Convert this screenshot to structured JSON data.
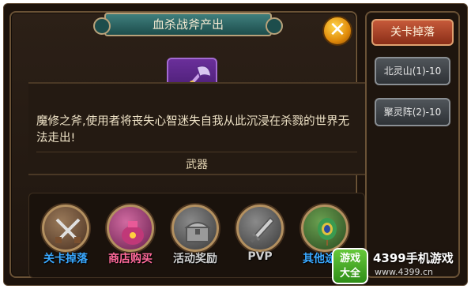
{
  "dialog": {
    "title": "血杀战斧产出",
    "close_glyph": "✕",
    "description": "魔修之斧,使用者将丧失心智迷失自我从此沉浸在杀戮的世界无法走出!",
    "item_type": "武器"
  },
  "sources": [
    {
      "label": "关卡掉落",
      "icon": "crossed-swords-icon",
      "color": "#3aa8ff"
    },
    {
      "label": "商店购买",
      "icon": "treasure-bag-icon",
      "color": "#ff6a9a"
    },
    {
      "label": "活动奖励",
      "icon": "treasure-chest-icon",
      "color": "#d0d0d0"
    },
    {
      "label": "PVP",
      "icon": "dagger-icon",
      "color": "#d0d0d0"
    },
    {
      "label": "其他途径",
      "icon": "peacock-feather-icon",
      "color": "#3aa8ff"
    }
  ],
  "side_panel": {
    "header": "关卡掉落",
    "stages": [
      "北灵山(1)-10",
      "聚灵阵(2)-10"
    ]
  },
  "watermark": {
    "badge_top": "游戏",
    "badge_bottom": "大全",
    "title": "4399手机游戏",
    "url": "www.4399.cn"
  }
}
